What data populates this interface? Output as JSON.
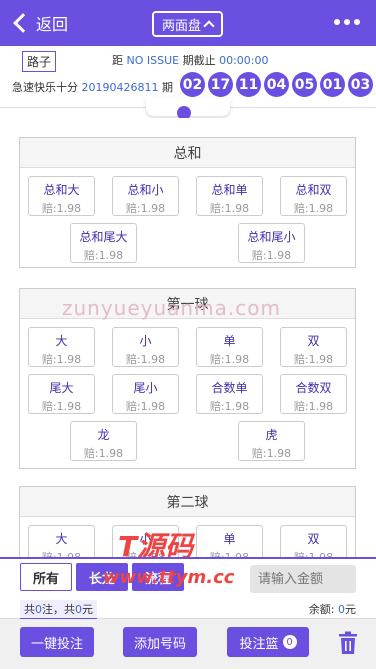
{
  "header": {
    "back_label": "返回",
    "mode_label": "两面盘"
  },
  "info": {
    "route_label": "路子",
    "deadline_prefix": "距",
    "deadline_issue": "NO ISSUE",
    "deadline_mid": "期截止",
    "deadline_time": "00:00:00",
    "game_name": "急速快乐十分",
    "issue_number": "20190426811",
    "issue_suffix": "期",
    "balls": [
      "02",
      "17",
      "11",
      "04",
      "05",
      "01",
      "03"
    ]
  },
  "groups": [
    {
      "title": "总和",
      "options": [
        {
          "name": "总和大",
          "odds": "赔:1.98"
        },
        {
          "name": "总和小",
          "odds": "赔:1.98"
        },
        {
          "name": "总和单",
          "odds": "赔:1.98"
        },
        {
          "name": "总和双",
          "odds": "赔:1.98"
        },
        {
          "name": "总和尾大",
          "odds": "赔:1.98"
        },
        {
          "name": "总和尾小",
          "odds": "赔:1.98"
        }
      ]
    },
    {
      "title": "第一球",
      "options": [
        {
          "name": "大",
          "odds": "赔:1.98"
        },
        {
          "name": "小",
          "odds": "赔:1.98"
        },
        {
          "name": "单",
          "odds": "赔:1.98"
        },
        {
          "name": "双",
          "odds": "赔:1.98"
        },
        {
          "name": "尾大",
          "odds": "赔:1.98"
        },
        {
          "name": "尾小",
          "odds": "赔:1.98"
        },
        {
          "name": "合数单",
          "odds": "赔:1.98"
        },
        {
          "name": "合数双",
          "odds": "赔:1.98"
        },
        {
          "name": "龙",
          "odds": "赔:1.98"
        },
        {
          "name": "虎",
          "odds": "赔:1.98"
        }
      ]
    },
    {
      "title": "第二球",
      "options": [
        {
          "name": "大",
          "odds": "赔:1.98"
        },
        {
          "name": "小",
          "odds": "赔:1.98"
        },
        {
          "name": "单",
          "odds": "赔:1.98"
        },
        {
          "name": "双",
          "odds": "赔:1.98"
        }
      ]
    }
  ],
  "watermarks": {
    "site": "zunyueyuanma.com",
    "brand": "T源码",
    "brand_url": "www.ttym.cc"
  },
  "betbar": {
    "filter_all": "所有",
    "filter_dragon": "长龙",
    "filter_flow": "流程",
    "amount_placeholder": "请输入金额"
  },
  "summary": {
    "prefix": "共",
    "bets": "0",
    "bets_unit": "注，共",
    "total": "0",
    "total_unit": "元",
    "balance_label": "余额:",
    "balance_value": "0",
    "balance_unit": "元"
  },
  "actions": {
    "quick_bet": "一键投注",
    "add_number": "添加号码",
    "basket": "投注篮",
    "basket_count": "0"
  },
  "colors": {
    "accent": "#6a4fe0",
    "link": "#3a6ad4",
    "watermark_red": "#e44444"
  }
}
